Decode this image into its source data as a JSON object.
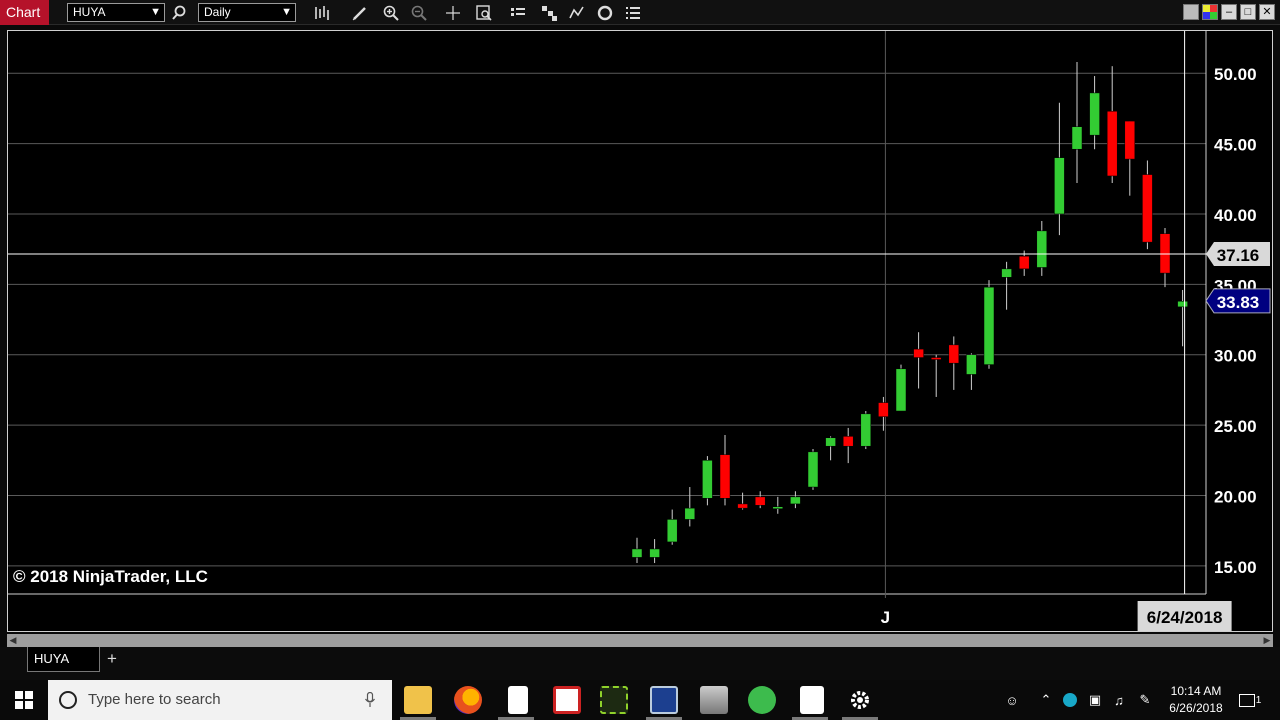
{
  "toolbar": {
    "chart_tab_label": "Chart",
    "instrument_value": "HUYA",
    "interval_value": "Daily",
    "icons": [
      "search-icon",
      "bar-type-icon",
      "draw-pencil-icon",
      "zoom-in-icon",
      "zoom-out-icon",
      "crosshair-icon",
      "data-box-icon",
      "properties-icon",
      "strategies-icon",
      "indicators-icon",
      "refresh-icon",
      "list-icon"
    ],
    "window_icons": [
      "restore-icon",
      "color-icon",
      "minimize-icon",
      "maximize-icon",
      "close-icon"
    ]
  },
  "chart": {
    "copyright": "© 2018 NinjaTrader, LLC",
    "x_tick_label": "J",
    "crosshair_date": "6/24/2018",
    "crosshair_price": "37.16",
    "last_price": "33.83"
  },
  "chart_data": {
    "type": "candlestick",
    "title": "",
    "instrument": "HUYA",
    "interval": "Daily",
    "ylim": [
      13.0,
      53.0
    ],
    "y_ticks": [
      "15.00",
      "20.00",
      "25.00",
      "30.00",
      "35.00",
      "40.00",
      "45.00",
      "50.00"
    ],
    "y_tick_values": [
      15,
      20,
      25,
      30,
      35,
      40,
      45,
      50
    ],
    "x_tick": {
      "label": "J",
      "index": 14
    },
    "crosshair": {
      "index": 31,
      "price": 37.16,
      "date": "6/24/2018"
    },
    "last_price": 33.83,
    "colors": {
      "up": "#33cc33",
      "down": "#ff0000",
      "grid": "#5a5a5a",
      "axis_text": "#ffffff",
      "last_price_bg": "#000080"
    },
    "candles": [
      {
        "o": 15.6,
        "h": 17.0,
        "l": 15.2,
        "c": 16.2
      },
      {
        "o": 15.6,
        "h": 16.9,
        "l": 15.2,
        "c": 16.2
      },
      {
        "o": 16.7,
        "h": 19.0,
        "l": 16.5,
        "c": 18.3
      },
      {
        "o": 18.3,
        "h": 20.6,
        "l": 17.8,
        "c": 19.1
      },
      {
        "o": 19.8,
        "h": 22.8,
        "l": 19.3,
        "c": 22.5
      },
      {
        "o": 22.9,
        "h": 24.3,
        "l": 19.3,
        "c": 19.8
      },
      {
        "o": 19.4,
        "h": 20.2,
        "l": 19.0,
        "c": 19.1
      },
      {
        "o": 19.9,
        "h": 20.3,
        "l": 19.1,
        "c": 19.3
      },
      {
        "o": 19.2,
        "h": 19.9,
        "l": 18.7,
        "c": 19.2
      },
      {
        "o": 19.4,
        "h": 20.3,
        "l": 19.1,
        "c": 19.9
      },
      {
        "o": 20.6,
        "h": 23.3,
        "l": 20.4,
        "c": 23.1
      },
      {
        "o": 23.5,
        "h": 24.2,
        "l": 22.5,
        "c": 24.1
      },
      {
        "o": 24.2,
        "h": 24.8,
        "l": 22.3,
        "c": 23.5
      },
      {
        "o": 23.5,
        "h": 26.0,
        "l": 23.3,
        "c": 25.8
      },
      {
        "o": 26.6,
        "h": 27.0,
        "l": 24.6,
        "c": 25.6
      },
      {
        "o": 26.0,
        "h": 29.3,
        "l": 26.0,
        "c": 29.0
      },
      {
        "o": 30.4,
        "h": 31.6,
        "l": 27.6,
        "c": 29.8
      },
      {
        "o": 29.8,
        "h": 30.0,
        "l": 27.0,
        "c": 29.7
      },
      {
        "o": 30.7,
        "h": 31.3,
        "l": 27.5,
        "c": 29.4
      },
      {
        "o": 28.6,
        "h": 30.1,
        "l": 27.5,
        "c": 30.0
      },
      {
        "o": 29.3,
        "h": 35.3,
        "l": 29.0,
        "c": 34.8
      },
      {
        "o": 35.5,
        "h": 36.6,
        "l": 33.2,
        "c": 36.1
      },
      {
        "o": 37.0,
        "h": 37.4,
        "l": 35.6,
        "c": 36.1
      },
      {
        "o": 36.2,
        "h": 39.5,
        "l": 35.6,
        "c": 38.8
      },
      {
        "o": 40.0,
        "h": 47.9,
        "l": 38.5,
        "c": 44.0
      },
      {
        "o": 44.6,
        "h": 50.8,
        "l": 42.2,
        "c": 46.2
      },
      {
        "o": 45.6,
        "h": 49.8,
        "l": 44.6,
        "c": 48.6
      },
      {
        "o": 47.3,
        "h": 50.5,
        "l": 42.2,
        "c": 42.7
      },
      {
        "o": 46.6,
        "h": 46.6,
        "l": 41.3,
        "c": 43.9
      },
      {
        "o": 42.8,
        "h": 43.8,
        "l": 37.5,
        "c": 38.0
      },
      {
        "o": 38.6,
        "h": 39.0,
        "l": 34.8,
        "c": 35.8
      },
      {
        "o": 33.4,
        "h": 34.6,
        "l": 30.6,
        "c": 33.8
      }
    ]
  },
  "bottom_tabs": {
    "active_tab": "HUYA",
    "add_label": "+"
  },
  "taskbar": {
    "search_placeholder": "Type here to search",
    "time": "10:14 AM",
    "date": "6/26/2018",
    "notification_count": "1",
    "apps": [
      "file-explorer-icon",
      "firefox-icon",
      "document-icon",
      "app-red-icon",
      "app-green-icon",
      "app-blue-icon",
      "app-server-icon",
      "app-green-robot-icon",
      "app-notes-icon",
      "settings-gear-icon"
    ]
  }
}
